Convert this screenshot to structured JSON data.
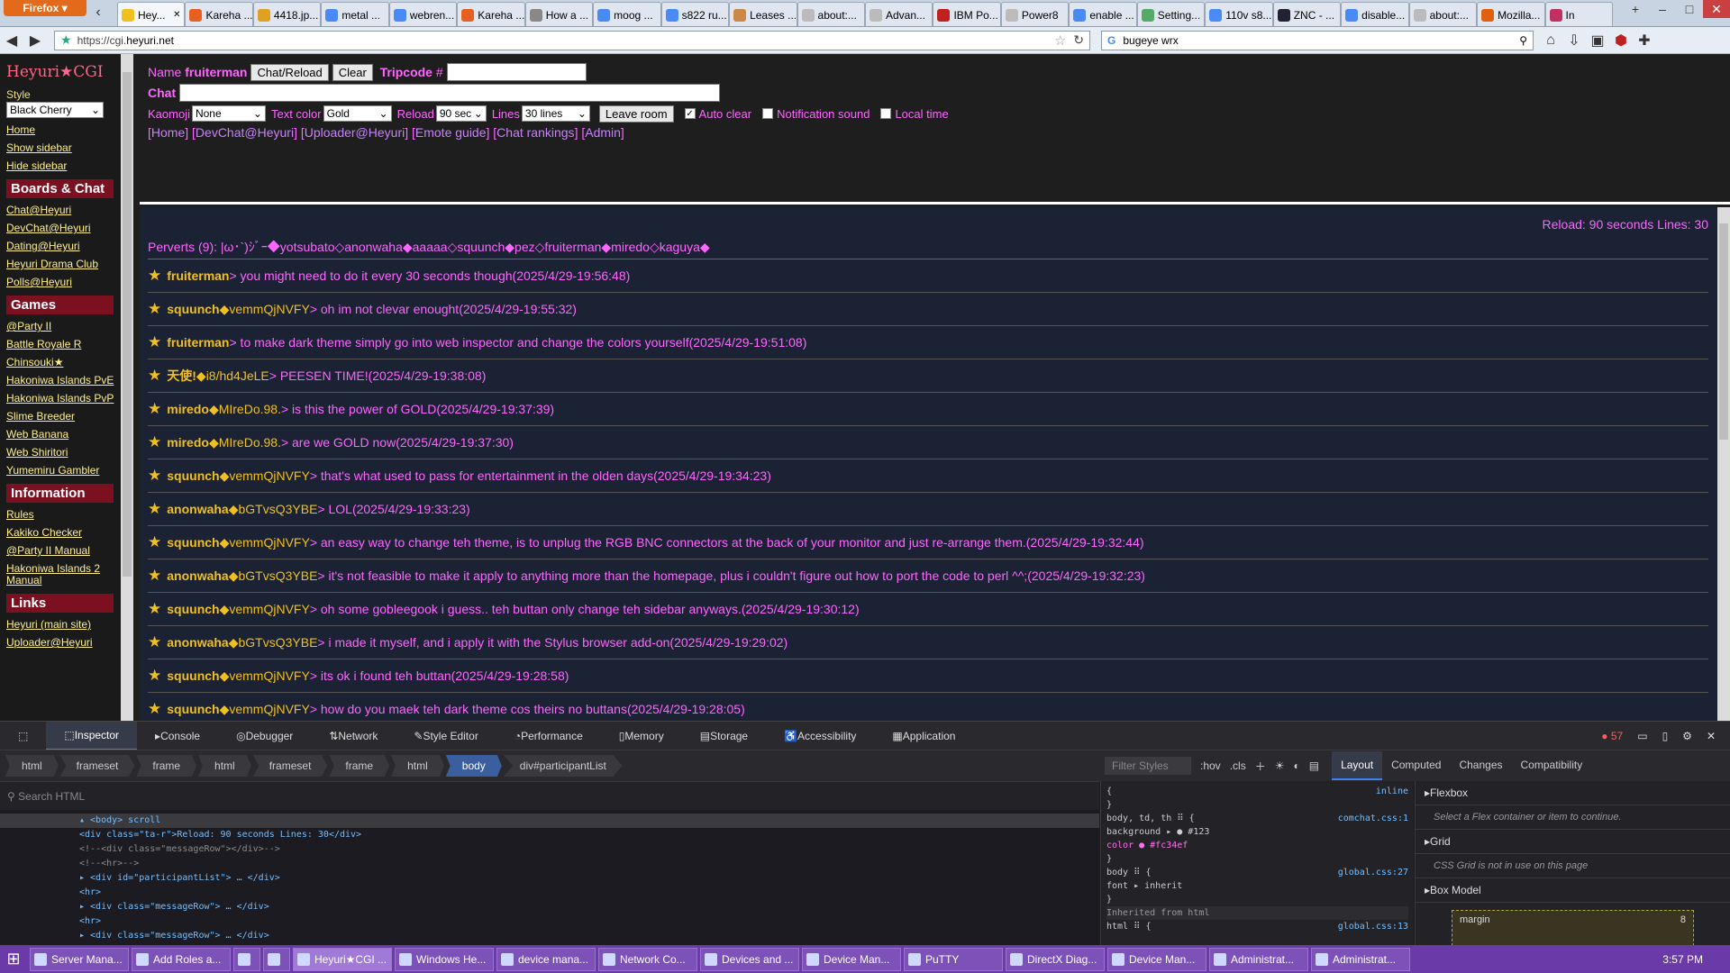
{
  "browser": {
    "app_button": "Firefox",
    "tabs": [
      "Hey...",
      "Kareha ...",
      "4418.jp...",
      "metal ...",
      "webren...",
      "Kareha ...",
      "How a ...",
      "moog ...",
      "s822 ru...",
      "Leases ...",
      "about:...",
      "Advan...",
      "IBM Po...",
      "Power8",
      "enable ...",
      "Setting...",
      "110v s8...",
      "ZNC - ...",
      "disable...",
      "about:...",
      "Mozilla...",
      "In"
    ],
    "tab_colors": [
      "#f0c020",
      "#e86020",
      "#e0a020",
      "#4a8af4",
      "#4a8af4",
      "#e86020",
      "#888",
      "#4a8af4",
      "#4a8af4",
      "#cc8844",
      "#bbb",
      "#bbb",
      "#c02020",
      "#bbb",
      "#4a8af4",
      "#5a6",
      "#4a8af4",
      "#223",
      "#4a8af4",
      "#bbb",
      "#e06010",
      "#c03060"
    ],
    "url_prefix": "https://cgi.",
    "url_domain": "heyuri.net",
    "search_value": "bugeye wrx"
  },
  "sidebar": {
    "brand": "Heyuri★CGI",
    "style_label": "Style",
    "style_value": "Black Cherry",
    "links_top": [
      "Home",
      "Show sidebar",
      "Hide sidebar"
    ],
    "sections": [
      {
        "title": "Boards & Chat",
        "links": [
          "Chat@Heyuri",
          "DevChat@Heyuri",
          "Dating@Heyuri",
          "Heyuri Drama Club",
          "Polls@Heyuri"
        ]
      },
      {
        "title": "Games",
        "links": [
          "@Party II",
          "Battle Royale R",
          "Chinsouki★",
          "Hakoniwa Islands PvE",
          "Hakoniwa Islands PvP",
          "Slime Breeder",
          "Web Banana",
          "Web Shiritori",
          "Yumemiru Gambler"
        ]
      },
      {
        "title": "Information",
        "links": [
          "Rules",
          "Kakiko Checker",
          "@Party II Manual",
          "Hakoniwa Islands 2 Manual"
        ]
      },
      {
        "title": "Links",
        "links": [
          "Heyuri (main site)",
          "Uploader@Heyuri"
        ]
      }
    ]
  },
  "controls": {
    "name_label": "Name",
    "name_value": "fruiterman",
    "chat_reload": "Chat/Reload",
    "clear": "Clear",
    "tripcode_label": "Tripcode",
    "tripcode_hash": "#",
    "chat_label": "Chat",
    "kaomoji_label": "Kaomoji",
    "kaomoji_value": "None",
    "textcolor_label": "Text color",
    "textcolor_value": "Gold",
    "reload_label": "Reload",
    "reload_value": "90 sec",
    "lines_label": "Lines",
    "lines_value": "30 lines",
    "leave_room": "Leave room",
    "auto_clear": "Auto clear",
    "notification_sound": "Notification sound",
    "local_time": "Local time",
    "nav_links": [
      "Home",
      "DevChat@Heyuri",
      "Uploader@Heyuri",
      "Emote guide",
      "Chat rankings",
      "Admin"
    ]
  },
  "chat": {
    "reload_info": "Reload: 90 seconds Lines: 30",
    "participants": "Perverts (9): |ω･`)ｼﾞｰ◆yotsubato◇anonwaha◆aaaaa◇squunch◆pez◇fruiterman◆miredo◇kaguya◆",
    "messages": [
      {
        "name": "fruiterman",
        "trip": "",
        "text": " > you might need to do it every 30 seconds though ",
        "time": "(2025/4/29-19:56:48)"
      },
      {
        "name": "squunch",
        "trip": "◆vemmQjNVFY",
        "text": " > oh im not clevar enought ",
        "time": "(2025/4/29-19:55:32)"
      },
      {
        "name": "fruiterman",
        "trip": "",
        "text": " > to make dark theme simply go into web inspector and change the colors yourself ",
        "time": "(2025/4/29-19:51:08)"
      },
      {
        "name": "天使!",
        "trip": "◆i8/hd4JeLE",
        "text": " > PEESEN TIME! ",
        "time": "(2025/4/29-19:38:08)"
      },
      {
        "name": "miredo",
        "trip": "◆MIreDo.98.",
        "text": " > is this the power of GOLD ",
        "time": "(2025/4/29-19:37:39)"
      },
      {
        "name": "miredo",
        "trip": "◆MIreDo.98.",
        "text": " > are we GOLD now ",
        "time": "(2025/4/29-19:37:30)"
      },
      {
        "name": "squunch",
        "trip": "◆vemmQjNVFY",
        "text": " > that's what used to pass for entertainment in the olden days ",
        "time": "(2025/4/29-19:34:23)"
      },
      {
        "name": "anonwaha",
        "trip": "◆bGTvsQ3YBE",
        "text": " > LOL ",
        "time": "(2025/4/29-19:33:23)"
      },
      {
        "name": "squunch",
        "trip": "◆vemmQjNVFY",
        "text": " > an easy way to change teh theme, is to unplug the RGB BNC connectors at the back of your monitor and just re-arrange them. ",
        "time": "(2025/4/29-19:32:44)"
      },
      {
        "name": "anonwaha",
        "trip": "◆bGTvsQ3YBE",
        "text": " > it's not feasible to make it apply to anything more than the homepage, plus i couldn't figure out how to port the code to perl ^^; ",
        "time": "(2025/4/29-19:32:23)"
      },
      {
        "name": "squunch",
        "trip": "◆vemmQjNVFY",
        "text": " > oh some gobleegook i guess.. teh buttan only change teh sidebar anyways. ",
        "time": "(2025/4/29-19:30:12)"
      },
      {
        "name": "anonwaha",
        "trip": "◆bGTvsQ3YBE",
        "text": " > i made it myself, and i apply it with the Stylus browser add-on ",
        "time": "(2025/4/29-19:29:02)"
      },
      {
        "name": "squunch",
        "trip": "◆vemmQjNVFY",
        "text": " > its ok i found teh buttan ",
        "time": "(2025/4/29-19:28:58)"
      },
      {
        "name": "squunch",
        "trip": "◆vemmQjNVFY",
        "text": " > how do you maek teh dark theme cos theirs no buttans ",
        "time": "(2025/4/29-19:28:05)"
      }
    ]
  },
  "devtools": {
    "tabs": [
      "Inspector",
      "Console",
      "Debugger",
      "Network",
      "Style Editor",
      "Performance",
      "Memory",
      "Storage",
      "Accessibility",
      "Application"
    ],
    "error_count": "57",
    "breadcrumbs": [
      "html",
      "frameset",
      "frame",
      "html",
      "frameset",
      "frame",
      "html",
      "body",
      "div#participantList"
    ],
    "filter_styles": "Filter Styles",
    "hov": ":hov",
    "cls": ".cls",
    "side_tabs": [
      "Layout",
      "Computed",
      "Changes",
      "Compatibility"
    ],
    "search_html": "Search HTML",
    "tree": [
      "<body> scroll",
      "<div class=\"ta-r\">Reload: 90 seconds Lines: 30</div>",
      "<!--<div class=\"messageRow\"></div>-->",
      "<!--<hr>-->",
      "<div id=\"participantList\"> … </div>",
      "<hr>",
      "<div class=\"messageRow\"> … </div>",
      "<hr>",
      "<div class=\"messageRow\"> … </div>"
    ],
    "rules": [
      "  {",
      "}",
      "body, td, th ⠿ {",
      "  background ▸ ● #123",
      "  color ● #fc34ef",
      "}",
      "body ⠿ {",
      "  font ▸ inherit",
      "}",
      "Inherited from html",
      "html ⠿ {"
    ],
    "rules_sources": [
      "inline",
      "comchat.css:1",
      "global.css:27",
      "global.css:13"
    ],
    "layout_sections": [
      "Flexbox",
      "Grid",
      "Box Model"
    ],
    "layout_notes": [
      "Select a Flex container or item to continue.",
      "CSS Grid is not in use on this page"
    ],
    "margin_label": "margin",
    "margin_value": "8"
  },
  "taskbar": {
    "items": [
      "Server Mana...",
      "Add Roles a...",
      "",
      "",
      "Heyuri★CGI ...",
      "Windows He...",
      "device mana...",
      "Network Co...",
      "Devices and ...",
      "Device Man...",
      "PuTTY",
      "DirectX Diag...",
      "Device Man...",
      "Administrat...",
      "Administrat..."
    ],
    "clock": "3:57 PM"
  }
}
